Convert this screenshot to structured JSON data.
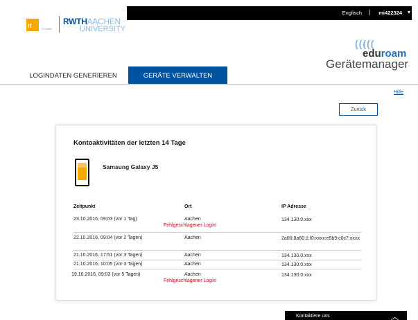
{
  "topbar": {
    "language": "Englisch",
    "separator": "|",
    "user": "mi422324",
    "caret": "▾"
  },
  "logo": {
    "it_label": "it",
    "it_center": "IT Center",
    "rwth_bold": "RWTH",
    "rwth_light": "AACHEN",
    "rwth_line2": "UNIVERSITY"
  },
  "brand": {
    "waves": "(((((",
    "edu": "edu",
    "roam": "roam",
    "product": "Gerätemanager"
  },
  "tabs": [
    {
      "label": "LOGINDATEN GENERIEREN",
      "active": false
    },
    {
      "label": "GERÄTE VERWALTEN",
      "active": true
    }
  ],
  "help": "Hilfe",
  "back_button": "Zurück",
  "card": {
    "title": "Kontoaktivitäten der letzten 14 Tage",
    "device_name": "Samsung Galaxy J5",
    "columns": [
      "Zeitpunkt",
      "Ort",
      "IP Adresse"
    ],
    "rows": [
      {
        "time": "23.10.2016, 09:03 (vor 1 Tag)",
        "place": "Aachen",
        "ip": "134.130.0.xxx",
        "error": "Fehlgeschlagener Login!"
      },
      {
        "time": "22.10.2016, 09:04 (vor 2 Tagen)",
        "place": "Aachen",
        "ip": "2a00:8a60:1:f0:xxxx:e5b9:c0c7:xxxx",
        "error": ""
      },
      {
        "time": "21.10.2016, 17:51 (vor 3 Tagen)",
        "place": "Aachen",
        "ip": "134.130.0.xxx",
        "error": ""
      },
      {
        "time": "21.10.2016, 10:05 (vor 3 Tagen)",
        "place": "Aachen",
        "ip": "134.130.0.xxx",
        "error": ""
      },
      {
        "time": "19.10.2016, 09:03 (vor 5 Tagen)",
        "place": "Aachen",
        "ip": "134.130.0.xxx",
        "error": "Fehlgeschlagener Login!"
      }
    ]
  },
  "contact": {
    "label": "Kontaktiere uns",
    "chevron": "︿"
  },
  "colors": {
    "rwth_blue": "#00549f",
    "error_red": "#b5121b",
    "it_orange": "#f5a800"
  }
}
